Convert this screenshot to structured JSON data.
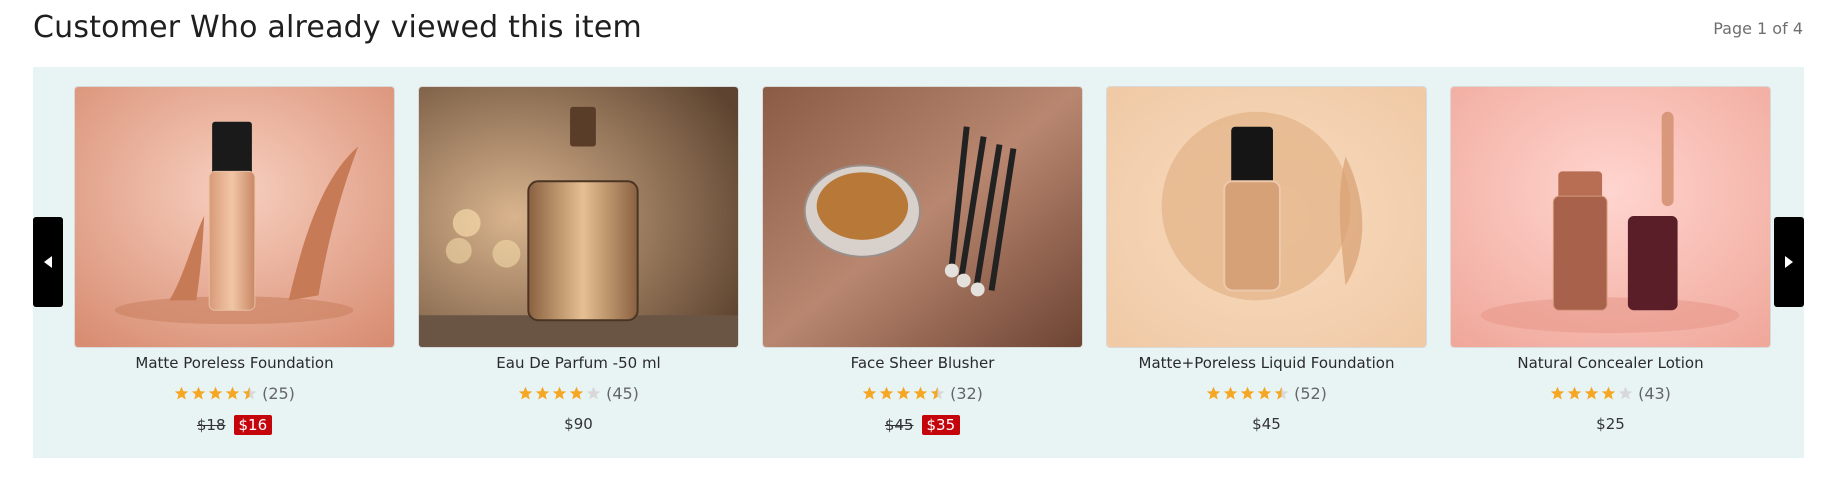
{
  "header": {
    "title": "Customer Who already viewed this item",
    "page_indicator": "Page 1 of 4"
  },
  "carousel": {
    "prev_icon": "chevron-left-icon",
    "next_icon": "chevron-right-icon",
    "star_color": "#f5a623",
    "sale_color": "#c4060c",
    "background": "#e8f4f4",
    "products": [
      {
        "name": "Matte Poreless Foundation",
        "rating": 4.5,
        "reviews": "(25)",
        "old_price": "$18",
        "price": "$16",
        "on_sale": true,
        "image": "foundation-bottle-splash"
      },
      {
        "name": "Eau De Parfum -50 ml",
        "rating": 4,
        "reviews": "(45)",
        "old_price": "",
        "price": "$90",
        "on_sale": false,
        "image": "perfume-bottle"
      },
      {
        "name": "Face Sheer Blusher",
        "rating": 4.5,
        "reviews": "(32)",
        "old_price": "$45",
        "price": "$35",
        "on_sale": true,
        "image": "powder-and-brushes"
      },
      {
        "name": "Matte+Poreless Liquid Foundation",
        "rating": 4.5,
        "reviews": "(52)",
        "old_price": "",
        "price": "$45",
        "on_sale": false,
        "image": "liquid-foundation-swatch"
      },
      {
        "name": "Natural Concealer Lotion",
        "rating": 4,
        "reviews": "(43)",
        "old_price": "",
        "price": "$25",
        "on_sale": false,
        "image": "concealer-tube"
      }
    ]
  }
}
